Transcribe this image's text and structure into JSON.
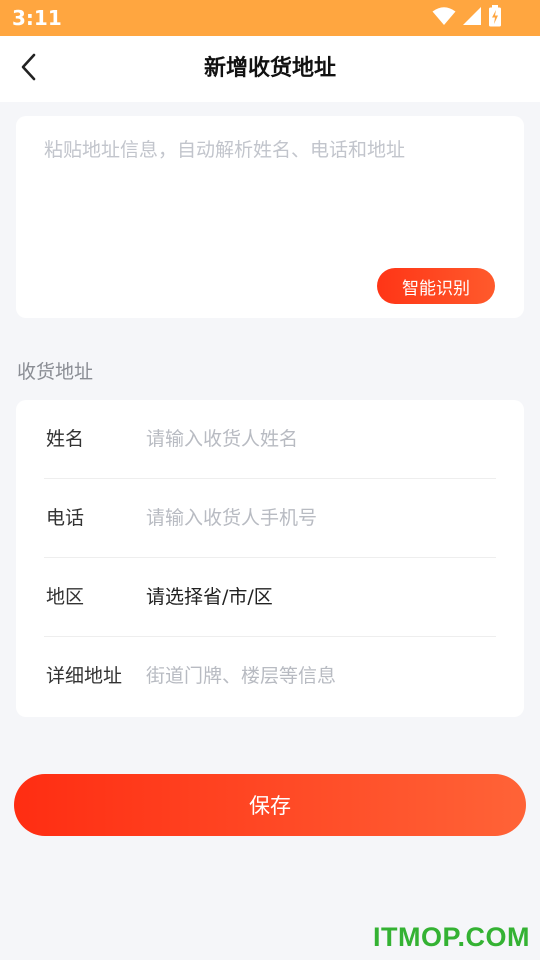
{
  "status_bar": {
    "time": "3:11",
    "icons": [
      "wifi-icon",
      "signal-icon",
      "battery-charging-icon"
    ],
    "background": "#ffa640"
  },
  "nav": {
    "title": "新增收货地址",
    "back_icon": "chevron-left-icon"
  },
  "paste_card": {
    "placeholder": "粘贴地址信息，自动解析姓名、电话和地址",
    "value": "",
    "recognize_label": "智能识别"
  },
  "section": {
    "title": "收货地址"
  },
  "form": {
    "name": {
      "label": "姓名",
      "placeholder": "请输入收货人姓名",
      "value": ""
    },
    "phone": {
      "label": "电话",
      "placeholder": "请输入收货人手机号",
      "value": ""
    },
    "region": {
      "label": "地区",
      "value": "请选择省/市/区"
    },
    "detail": {
      "label": "详细地址",
      "placeholder": "街道门牌、楼层等信息",
      "value": ""
    }
  },
  "save_label": "保存",
  "watermark": {
    "text": "ITMOP.COM",
    "color": "#34b233"
  },
  "colors": {
    "accent_start": "#ff2d12",
    "accent_end": "#ff6337",
    "page_background": "#f5f6f9"
  }
}
